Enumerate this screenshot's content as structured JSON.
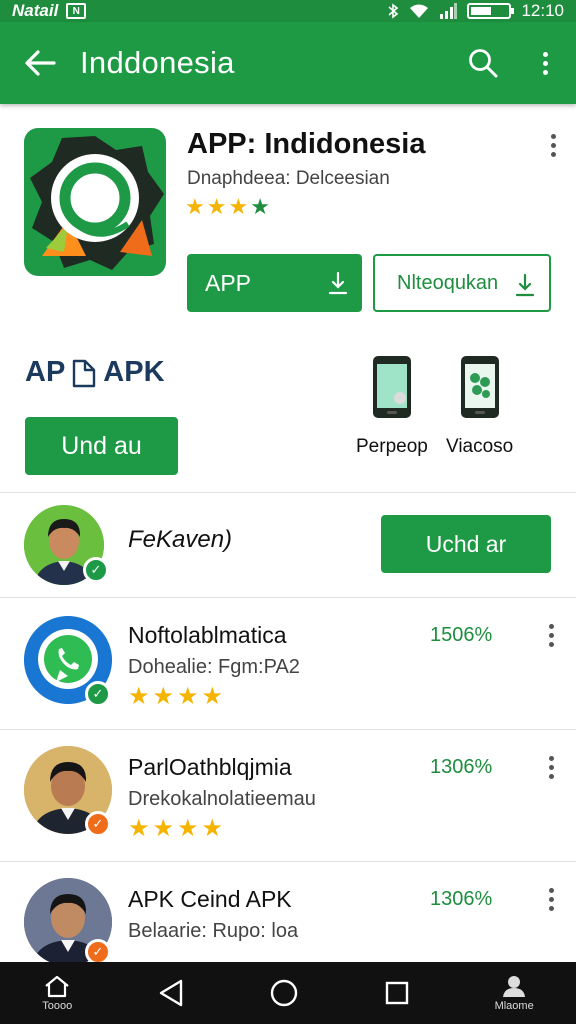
{
  "status_bar": {
    "carrier": "Natail",
    "carrier_icon": "N",
    "time": "12:10",
    "battery_level": 0.55
  },
  "app_bar": {
    "title": "Inddonesia"
  },
  "app": {
    "name": "APP: Indidonesia",
    "subtitle": "Dnaphdeea: Delceesian",
    "rating_stars": 4,
    "primary_button": "APP",
    "secondary_button": "Nlteoqukan",
    "apk_label_left": "AP",
    "apk_label_right": "APK",
    "small_button": "Und au",
    "tiles": [
      {
        "label": "Perpeop",
        "icon": "phone-screen-icon"
      },
      {
        "label": "Viacoso",
        "icon": "phone-gallery-icon"
      }
    ]
  },
  "user": {
    "name": "FeKaven)",
    "button": "Uchd ar"
  },
  "list": [
    {
      "name": "Noftolablmatica",
      "sub": "Dohealie: Fgm:PA2",
      "pct": "1506%",
      "stars": "★★★★",
      "avatar": "whatsapp-logo-icon",
      "badge_color": "#1e9a46"
    },
    {
      "name": "ParlOathblqjmia",
      "sub": "Drekokalnolatieemau",
      "pct": "1306%",
      "stars": "★★★★",
      "avatar": "person-avatar",
      "badge_color": "#ef6c1a"
    },
    {
      "name": "APK Ceind APK",
      "sub": "Belaarie: Rupo: loa",
      "pct": "1306%",
      "stars": "",
      "avatar": "person-avatar",
      "badge_color": "#ef6c1a"
    }
  ],
  "nav": {
    "home_label": "Toooo",
    "profile_label": "Mlaome"
  },
  "colors": {
    "brand_green": "#1e9a46",
    "star_yellow": "#f4b400",
    "badge_orange": "#ef6c1a"
  }
}
